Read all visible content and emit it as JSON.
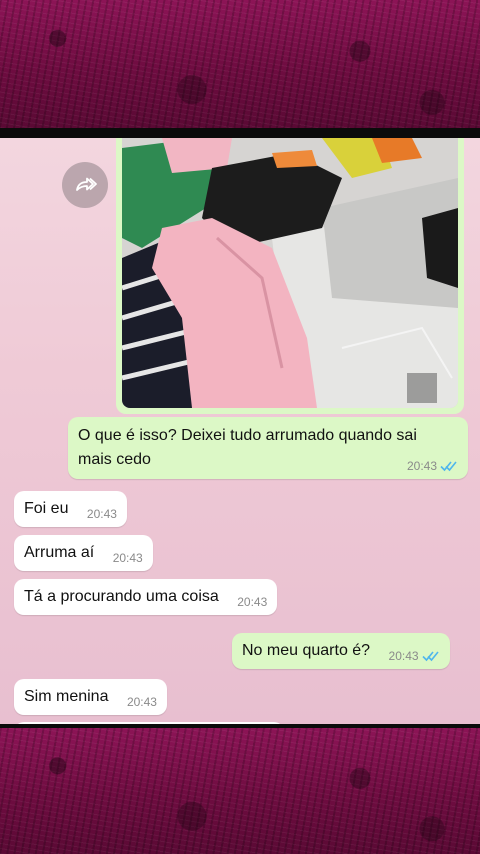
{
  "chat": {
    "messages": [
      {
        "id": "msg1",
        "direction": "out",
        "text": "O que é isso? Deixei tudo arrumado quando sai mais cedo",
        "time": "20:43",
        "read": true
      },
      {
        "id": "msg2",
        "direction": "in",
        "text": "Foi eu",
        "time": "20:43"
      },
      {
        "id": "msg3",
        "direction": "in",
        "text": "Arruma aí",
        "time": "20:43"
      },
      {
        "id": "msg4",
        "direction": "in",
        "text": "Tá a procurando uma coisa",
        "time": "20:43"
      },
      {
        "id": "msg5",
        "direction": "out",
        "text": "No meu quarto é?",
        "time": "20:43",
        "read": true
      },
      {
        "id": "msg6",
        "direction": "in",
        "text": "Sim menina",
        "time": "20:43"
      }
    ]
  },
  "icons": {
    "forward": "forward-icon",
    "read_ticks": "double-check-icon"
  },
  "colors": {
    "outgoing_bubble": "#dcf8c6",
    "incoming_bubble": "#ffffff",
    "read_ticks": "#4fb6ec",
    "frame": "#7a0f4a"
  }
}
